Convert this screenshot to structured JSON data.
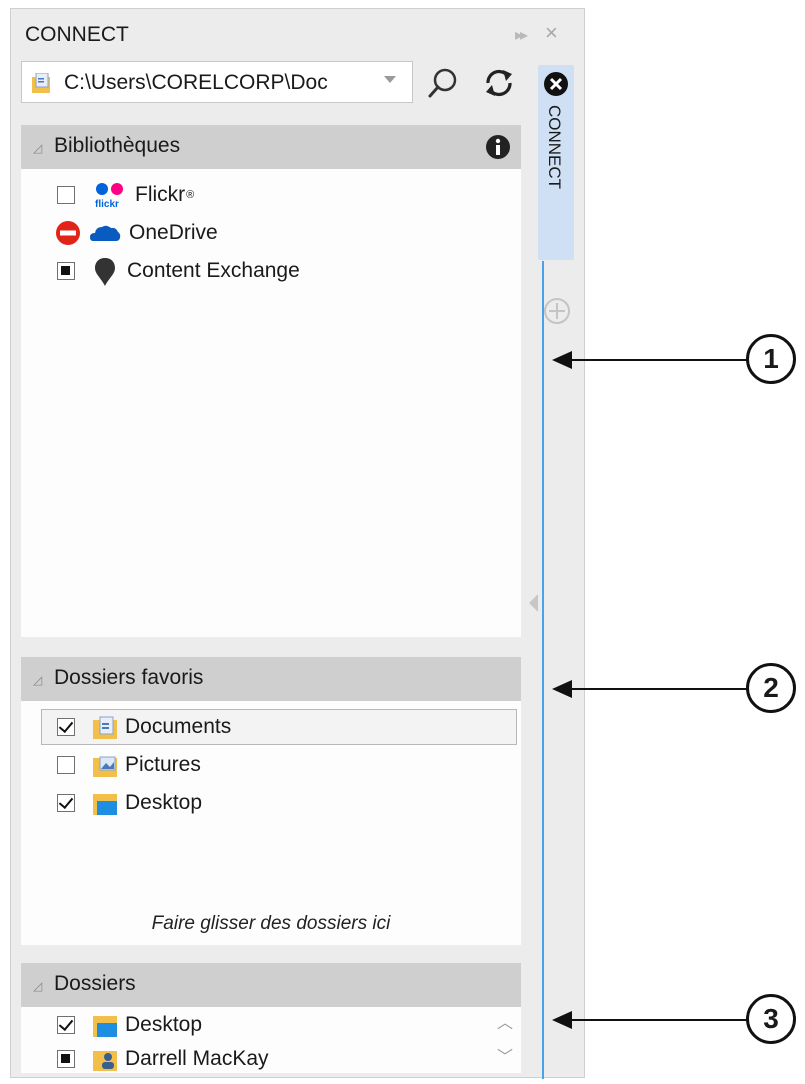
{
  "panel": {
    "title": "CONNECT",
    "path": "C:\\Users\\CORELCORP\\Doc"
  },
  "libraries": {
    "header": "Bibliothèques",
    "items": [
      {
        "label": "Flickr",
        "mark": "®",
        "state": "unchecked"
      },
      {
        "label": "OneDrive",
        "state": "blocked"
      },
      {
        "label": "Content Exchange",
        "state": "partial"
      }
    ]
  },
  "favorites": {
    "header": "Dossiers favoris",
    "items": [
      {
        "label": "Documents",
        "state": "checked",
        "selected": true
      },
      {
        "label": "Pictures",
        "state": "unchecked"
      },
      {
        "label": "Desktop",
        "state": "checked"
      }
    ],
    "hint": "Faire glisser des dossiers ici"
  },
  "folders": {
    "header": "Dossiers",
    "items": [
      {
        "label": "Desktop",
        "state": "checked"
      },
      {
        "label": "Darrell MacKay",
        "state": "partial"
      }
    ]
  },
  "side_tab": {
    "label": "CONNECT"
  },
  "callouts": [
    "1",
    "2",
    "3"
  ],
  "colors": {
    "accent_line": "#4aa3e8",
    "tab_bg": "#cfe0f4",
    "header_bg": "#cfcfcf",
    "blocked_red": "#e2231a",
    "flickr_blue": "#0063dc",
    "flickr_pink": "#ff0084",
    "onedrive_blue": "#0a5bbf"
  }
}
